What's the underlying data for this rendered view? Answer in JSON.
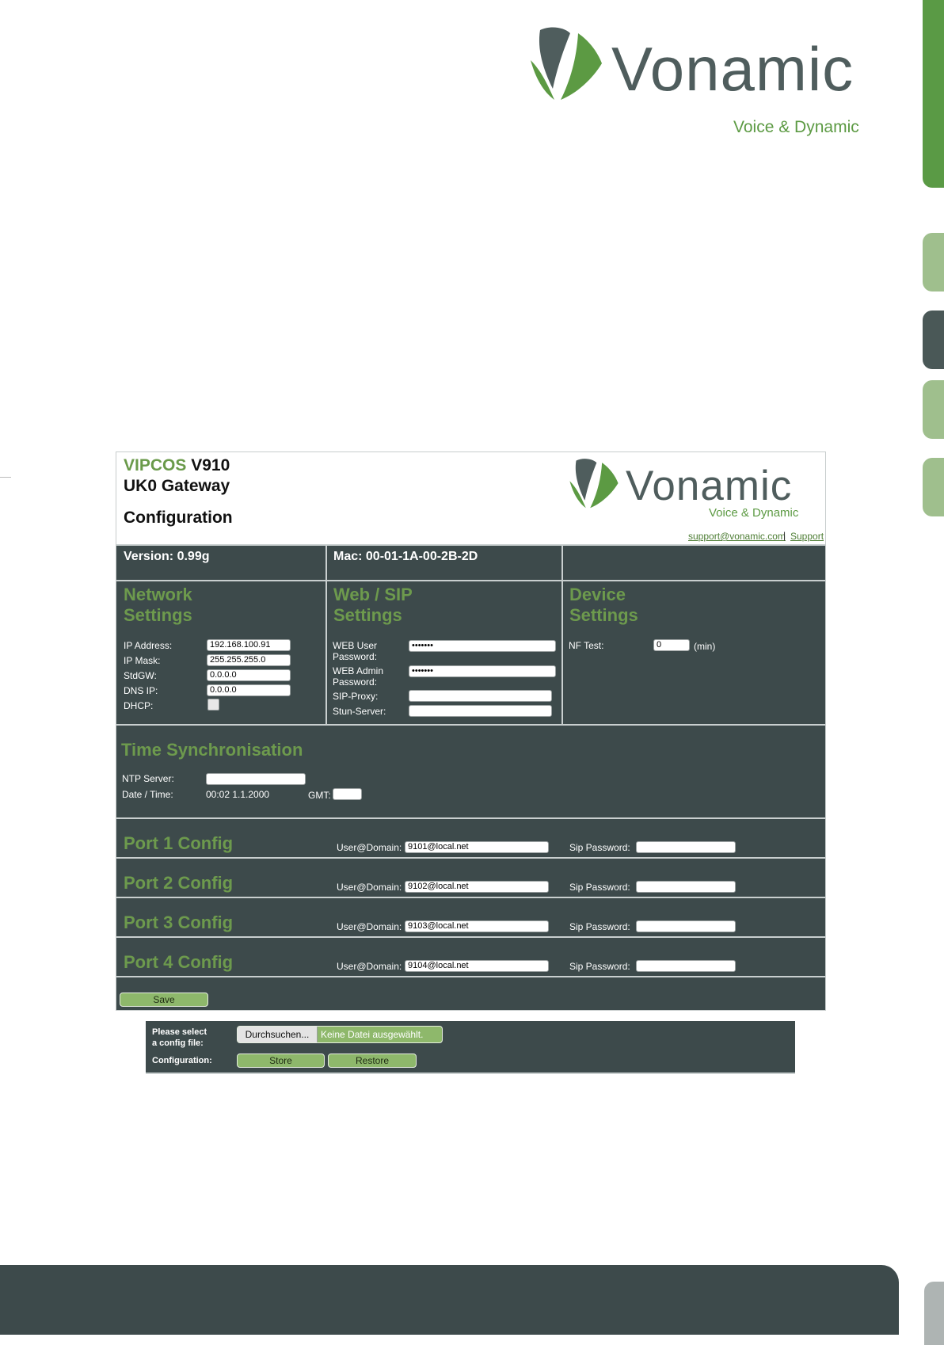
{
  "logo_brand": "Vonamic",
  "logo_tagline": "Voice & Dynamic",
  "header": {
    "brand": "VIPCOS",
    "model": "V910",
    "product": "UK0 Gateway",
    "page_title": "Configuration",
    "support_email": "support@vonamic.com",
    "separator": "|",
    "support_link": "Support"
  },
  "info": {
    "version": "Version: 0.99g",
    "mac": "Mac: 00-01-1A-00-2B-2D"
  },
  "network": {
    "title_line1": "Network",
    "title_line2": "Settings",
    "ip_label": "IP Address:",
    "ip_value": "192.168.100.91",
    "mask_label": "IP Mask:",
    "mask_value": "255.255.255.0",
    "gw_label": "StdGW:",
    "gw_value": "0.0.0.0",
    "dns_label": "DNS IP:",
    "dns_value": "0.0.0.0",
    "dhcp_label": "DHCP:"
  },
  "websip": {
    "title_line1": "Web / SIP",
    "title_line2": "Settings",
    "web_user_label_1": "WEB User",
    "web_user_label_2": "Password:",
    "web_user_value": "•••••••",
    "web_admin_label_1": "WEB Admin",
    "web_admin_label_2": "Password:",
    "web_admin_value": "•••••••",
    "sip_proxy_label": "SIP-Proxy:",
    "sip_proxy_value": "",
    "stun_label": "Stun-Server:",
    "stun_value": ""
  },
  "device": {
    "title_line1": "Device",
    "title_line2": "Settings",
    "nf_label": "NF Test:",
    "nf_value": "0",
    "nf_unit": "(min)"
  },
  "time": {
    "title": "Time Synchronisation",
    "ntp_label": "NTP Server:",
    "ntp_value": "",
    "date_label": "Date / Time:",
    "date_value": "00:02 1.1.2000",
    "gmt_label": "GMT:",
    "gmt_value": ""
  },
  "ports": [
    {
      "title": "Port 1 Config",
      "user_label": "User@Domain:",
      "user_value": "9101@local.net",
      "pw_label": "Sip Password:",
      "pw_value": ""
    },
    {
      "title": "Port 2 Config",
      "user_label": "User@Domain:",
      "user_value": "9102@local.net",
      "pw_label": "Sip Password:",
      "pw_value": ""
    },
    {
      "title": "Port 3 Config",
      "user_label": "User@Domain:",
      "user_value": "9103@local.net",
      "pw_label": "Sip Password:",
      "pw_value": ""
    },
    {
      "title": "Port 4 Config",
      "user_label": "User@Domain:",
      "user_value": "9104@local.net",
      "pw_label": "Sip Password:",
      "pw_value": ""
    }
  ],
  "save_label": "Save",
  "file": {
    "select_label_1": "Please select",
    "select_label_2": "a config file:",
    "browse_label": "Durchsuchen...",
    "no_file_label": "Keine Datei ausgewählt.",
    "config_label": "Configuration:",
    "store_label": "Store",
    "restore_label": "Restore"
  },
  "colors": {
    "panel": "#3d4a4b",
    "accent_green": "#6d9a4d",
    "button_green": "#8eb86b",
    "logo_grey": "#4f5d5d"
  }
}
